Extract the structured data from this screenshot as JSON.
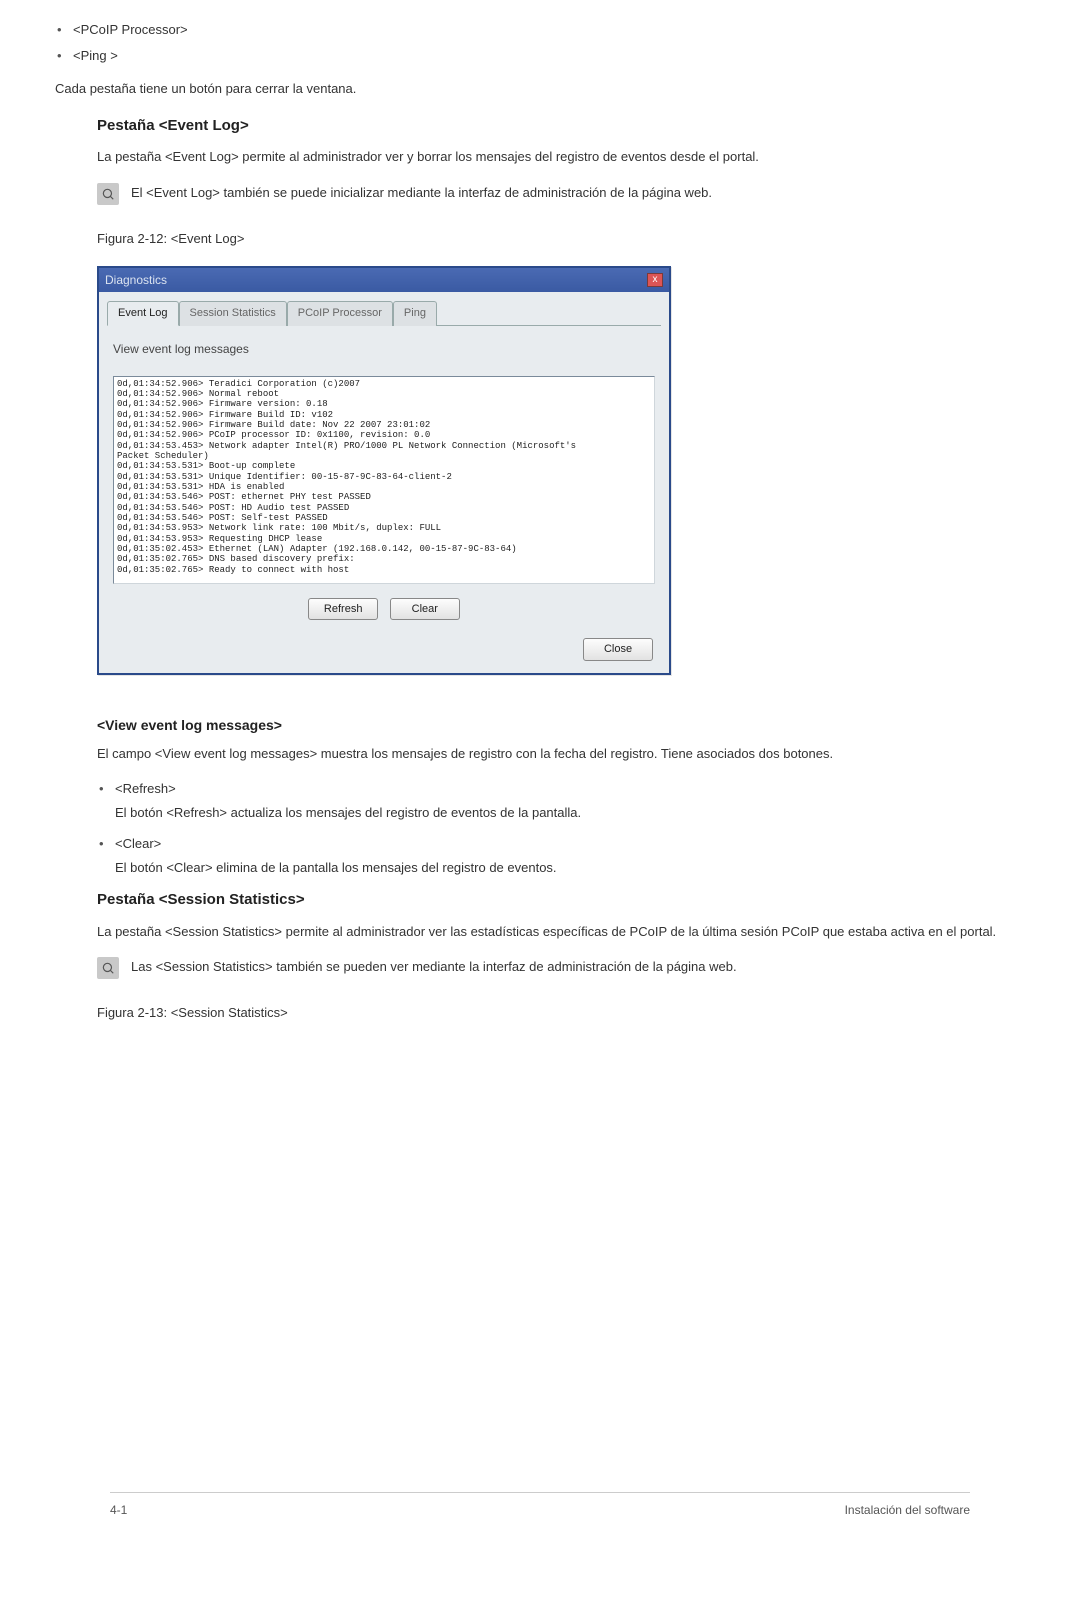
{
  "top_bullets": [
    "<PCoIP Processor>",
    "<Ping >"
  ],
  "intro_para": "Cada pestaña tiene un botón para cerrar la ventana.",
  "event_log": {
    "heading": "Pestaña <Event Log>",
    "desc": "La pestaña <Event Log> permite al administrador ver y borrar los mensajes del registro de eventos desde el portal.",
    "note": "El <Event Log> también se puede inicializar mediante la interfaz de administración de la página web.",
    "figure_caption": "Figura 2-12: <Event Log>"
  },
  "window": {
    "title": "Diagnostics",
    "close": "x",
    "tabs": [
      "Event Log",
      "Session Statistics",
      "PCoIP Processor",
      "Ping"
    ],
    "panel_label": "View event log messages",
    "log_text": "0d,01:34:52.906> Teradici Corporation (c)2007\n0d,01:34:52.906> Normal reboot\n0d,01:34:52.906> Firmware version: 0.18\n0d,01:34:52.906> Firmware Build ID: v102\n0d,01:34:52.906> Firmware Build date: Nov 22 2007 23:01:02\n0d,01:34:52.906> PCoIP processor ID: 0x1100, revision: 0.0\n0d,01:34:53.453> Network adapter Intel(R) PRO/1000 PL Network Connection (Microsoft's\nPacket Scheduler)\n0d,01:34:53.531> Boot-up complete\n0d,01:34:53.531> Unique Identifier: 00-15-87-9C-83-64-client-2\n0d,01:34:53.531> HDA is enabled\n0d,01:34:53.546> POST: ethernet PHY test PASSED\n0d,01:34:53.546> POST: HD Audio test PASSED\n0d,01:34:53.546> POST: Self-test PASSED\n0d,01:34:53.953> Network link rate: 100 Mbit/s, duplex: FULL\n0d,01:34:53.953> Requesting DHCP lease\n0d,01:35:02.453> Ethernet (LAN) Adapter (192.168.0.142, 00-15-87-9C-83-64)\n0d,01:35:02.765> DNS based discovery prefix:\n0d,01:35:02.765> Ready to connect with host",
    "refresh_label": "Refresh",
    "clear_label": "Clear",
    "close_label": "Close"
  },
  "view_msgs": {
    "heading": "<View event log messages>",
    "desc": "El campo <View event log messages> muestra los mensajes de registro con la fecha del registro. Tiene asociados dos botones.",
    "items": [
      {
        "label": "<Refresh>",
        "desc": "El botón <Refresh> actualiza los mensajes del registro de eventos de la pantalla."
      },
      {
        "label": "<Clear>",
        "desc": "El botón <Clear> elimina de la pantalla los mensajes del registro de eventos."
      }
    ]
  },
  "session_stats": {
    "heading": "Pestaña <Session Statistics>",
    "desc": "La pestaña <Session Statistics> permite al administrador ver las estadísticas específicas de PCoIP de la última sesión PCoIP que estaba activa en el portal.",
    "note": "Las <Session Statistics> también se pueden ver mediante la interfaz de administración de la página web.",
    "figure_caption": "Figura 2-13: <Session Statistics>"
  },
  "footer": {
    "left": "4-1",
    "right": "Instalación del software"
  }
}
